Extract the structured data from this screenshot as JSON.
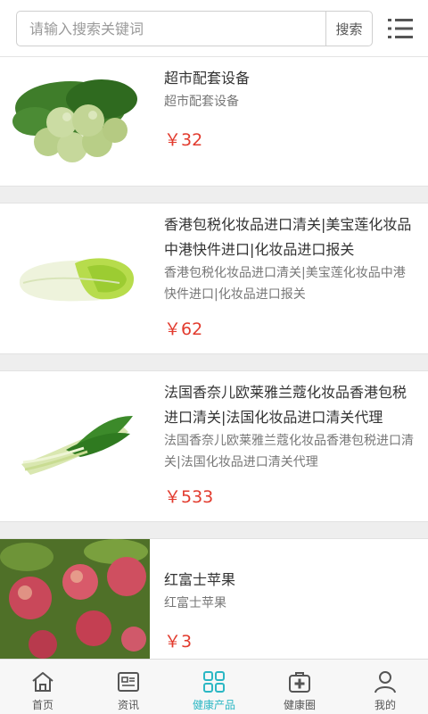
{
  "search": {
    "placeholder": "请输入搜索关键词",
    "button_label": "搜索"
  },
  "products": [
    {
      "title": "超市配套设备",
      "description": "超市配套设备",
      "price": "￥32",
      "image": "bok-choy-bunch"
    },
    {
      "title": "香港包税化妆品进口清关|美宝莲化妆品中港快件进口|化妆品进口报关",
      "description": "香港包税化妆品进口清关|美宝莲化妆品中港快件进口|化妆品进口报关",
      "price": "￥62",
      "image": "napa-cabbage"
    },
    {
      "title": "法国香奈儿欧莱雅兰蔻化妆品香港包税进口清关|法国化妆品进口清关代理",
      "description": "法国香奈儿欧莱雅兰蔻化妆品香港包税进口清关|法国化妆品进口清关代理",
      "price": "￥533",
      "image": "green-onion-bok-choy"
    },
    {
      "title": "红富士苹果",
      "description": "红富士苹果",
      "price": "￥3",
      "image": "apples-on-tree"
    }
  ],
  "tabbar": {
    "tabs": [
      {
        "label": "首页",
        "icon": "home-icon",
        "active": false
      },
      {
        "label": "资讯",
        "icon": "news-icon",
        "active": false
      },
      {
        "label": "健康产品",
        "icon": "grid-icon",
        "active": true
      },
      {
        "label": "健康圈",
        "icon": "medical-kit-icon",
        "active": false
      },
      {
        "label": "我的",
        "icon": "user-icon",
        "active": false
      }
    ],
    "active_color": "#2bb7c4",
    "inactive_color": "#555555"
  },
  "colors": {
    "price": "#e23b2e",
    "separator": "#eeeeee"
  }
}
